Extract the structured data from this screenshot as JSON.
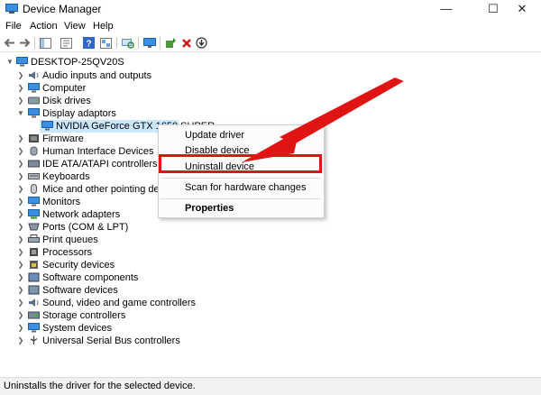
{
  "window": {
    "title": "Device Manager",
    "controls": {
      "minimize": "—",
      "maximize": "☐",
      "close": "✕"
    }
  },
  "menu": [
    "File",
    "Action",
    "View",
    "Help"
  ],
  "toolbar": {
    "icons": [
      "back-arrow-icon",
      "forward-arrow-icon",
      "show-hide-console-tree-icon",
      "properties-icon",
      "help-icon",
      "view-icon",
      "scan-hardware-icon",
      "monitor-icon",
      "update-driver-icon",
      "uninstall-icon",
      "disable-device-icon"
    ]
  },
  "tree": {
    "root": "DESKTOP-25QV20S",
    "categories": [
      {
        "label": "Audio inputs and outputs",
        "icon": "speaker-icon"
      },
      {
        "label": "Computer",
        "icon": "computer-icon"
      },
      {
        "label": "Disk drives",
        "icon": "disk-drive-icon"
      },
      {
        "label": "Display adaptors",
        "icon": "display-adapter-icon",
        "expanded": true
      },
      {
        "label": "Firmware",
        "icon": "firmware-icon"
      },
      {
        "label": "Human Interface Devices",
        "icon": "hid-icon"
      },
      {
        "label": "IDE ATA/ATAPI controllers",
        "icon": "ide-controller-icon"
      },
      {
        "label": "Keyboards",
        "icon": "keyboard-icon"
      },
      {
        "label": "Mice and other pointing device",
        "icon": "mouse-icon"
      },
      {
        "label": "Monitors",
        "icon": "monitor-icon"
      },
      {
        "label": "Network adapters",
        "icon": "network-adapter-icon"
      },
      {
        "label": "Ports (COM & LPT)",
        "icon": "port-icon"
      },
      {
        "label": "Print queues",
        "icon": "printer-icon"
      },
      {
        "label": "Processors",
        "icon": "processor-icon"
      },
      {
        "label": "Security devices",
        "icon": "security-device-icon"
      },
      {
        "label": "Software components",
        "icon": "software-component-icon"
      },
      {
        "label": "Software devices",
        "icon": "software-device-icon"
      },
      {
        "label": "Sound, video and game controllers",
        "icon": "sound-controller-icon"
      },
      {
        "label": "Storage controllers",
        "icon": "storage-controller-icon"
      },
      {
        "label": "System devices",
        "icon": "system-device-icon"
      },
      {
        "label": "Universal Serial Bus controllers",
        "icon": "usb-icon"
      }
    ],
    "display_child": "NVIDIA GeForce GTX 1650 SUPER"
  },
  "context_menu": {
    "items": [
      "Update driver",
      "Disable device",
      "Uninstall device",
      "Scan for hardware changes",
      "Properties"
    ],
    "highlighted": "Uninstall device"
  },
  "status": "Uninstalls the driver for the selected device.",
  "colors": {
    "selection": "#cce8ff",
    "annotation_red": "#e11414",
    "icon_blue": "#2f7fd0"
  }
}
